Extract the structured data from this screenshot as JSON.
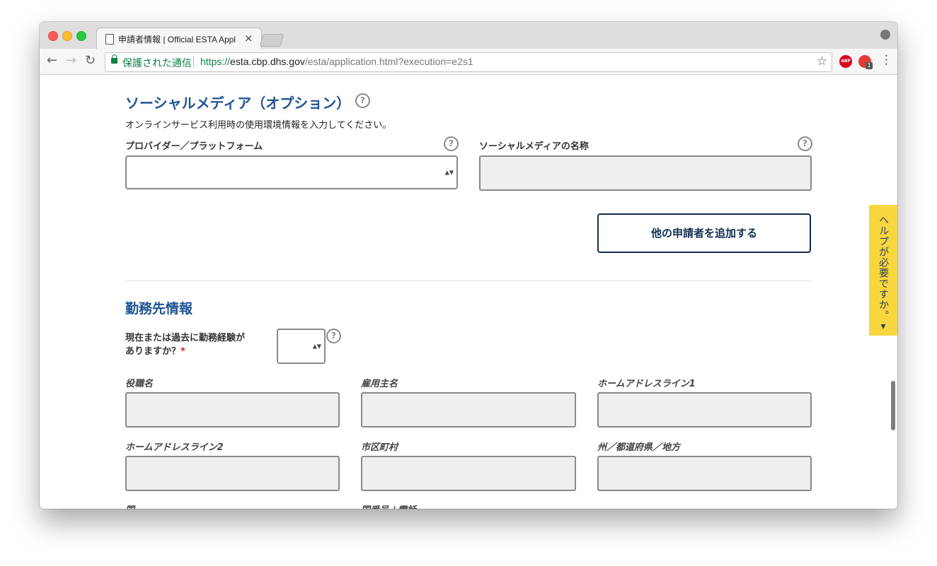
{
  "browser": {
    "tab_title": "申請者情報 | Official ESTA Appl",
    "tab_close": "×",
    "secure_label": "保護された通信",
    "url_scheme": "https://",
    "url_host": "esta.cbp.dhs.gov",
    "url_path": "/esta/application.html?execution=e2s1",
    "back_icon": "←",
    "forward_icon": "→",
    "reload_icon": "↻",
    "star_icon": "☆",
    "menu_icon": "⋮",
    "abp_label": "ABP",
    "ext_badge": "1"
  },
  "social": {
    "heading": "ソーシャルメディア（オプション）",
    "description": "オンラインサービス利用時の使用環境情報を入力してください。",
    "provider_label": "プロバイダー／プラットフォーム",
    "name_label": "ソーシャルメディアの名称",
    "provider_value": "",
    "name_value": ""
  },
  "add_applicant_button": "他の申請者を追加する",
  "employment": {
    "heading": "勤務先情報",
    "question_line1": "現在または過去に勤務経験が",
    "question_line2": "ありますか？",
    "required_mark": "*",
    "fields": {
      "job_title": "役職名",
      "employer": "雇用主名",
      "address1": "ホームアドレスライン1",
      "address2": "ホームアドレスライン2",
      "city": "市区町村",
      "state": "州／都道府県／地方",
      "country": "国",
      "phone": "国番号＋電話"
    }
  },
  "help_tab": "ヘルプが必要ですか。▾",
  "help_symbol": "?",
  "select_arrows": "▲▼"
}
